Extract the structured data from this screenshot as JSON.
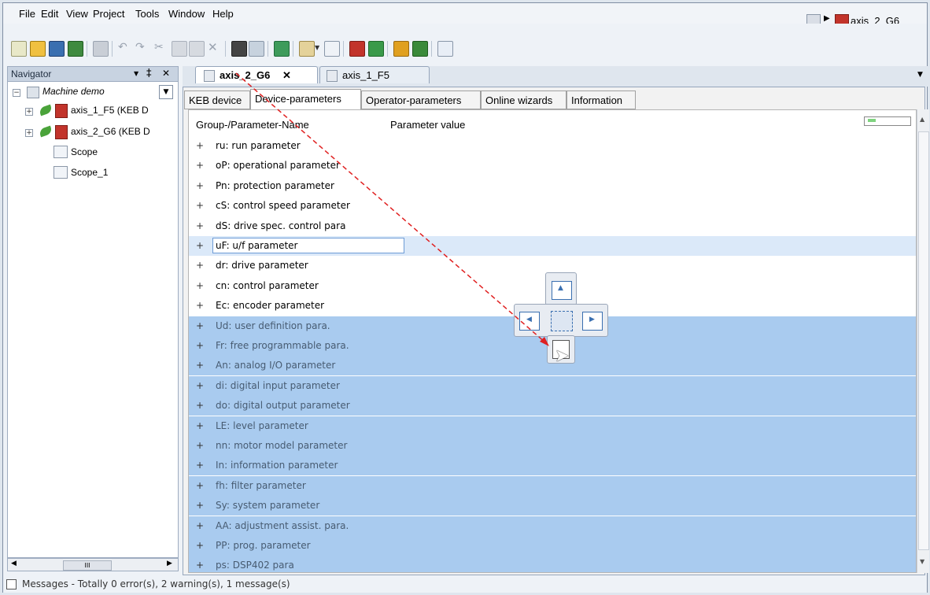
{
  "menu": [
    "File",
    "Edit",
    "View",
    "Project",
    "Tools",
    "Window",
    "Help"
  ],
  "menu_underline": [
    "F",
    "E",
    "V",
    "P",
    "T",
    "W",
    "H"
  ],
  "path": {
    "label": "axis_2_G6"
  },
  "navigator": {
    "title": "Navigator",
    "pin": "‡",
    "close": "✕",
    "dropdown": "▼",
    "root": "Machine demo",
    "items": [
      "axis_1_F5 (KEB D",
      "axis_2_G6 (KEB D",
      "Scope",
      "Scope_1"
    ],
    "hscroll_thumb": "III"
  },
  "doc_tabs": [
    {
      "label": "axis_2_G6",
      "close": "✕",
      "active": true
    },
    {
      "label": "axis_1_F5",
      "active": false
    }
  ],
  "param_tabs": [
    "KEB device",
    "Device-parameters",
    "Operator-parameters",
    "Online wizards",
    "Information"
  ],
  "grid": {
    "col_name": "Group-/Parameter-Name",
    "col_value": "Parameter value",
    "rows": [
      "ru: run parameter",
      "oP: operational parameter",
      "Pn: protection parameter",
      "cS: control speed parameter",
      "dS: drive spec. control para",
      "uF: u/f parameter",
      "dr: drive parameter",
      "cn: control parameter",
      "Ec: encoder parameter",
      "Ud: user definition para.",
      "Fr: free programmable para.",
      "An: analog I/O parameter",
      "di: digital input parameter",
      "do: digital output parameter",
      "LE: level parameter",
      "nn: motor model parameter",
      "In: information parameter",
      "fh: filter parameter",
      "Sy: system parameter",
      "AA: adjustment assist. para.",
      "PP: prog. parameter",
      "ps: DSP402 para"
    ],
    "focused_row": 5,
    "selected_from_row": 9
  },
  "messages": {
    "label": "Messages - Totally 0 error(s), 2 warning(s), 1 message(s)"
  },
  "colors": {
    "selection": "#a9cbef",
    "drag_arrow": "#e02020",
    "nav_header": "#c8d3e1"
  }
}
